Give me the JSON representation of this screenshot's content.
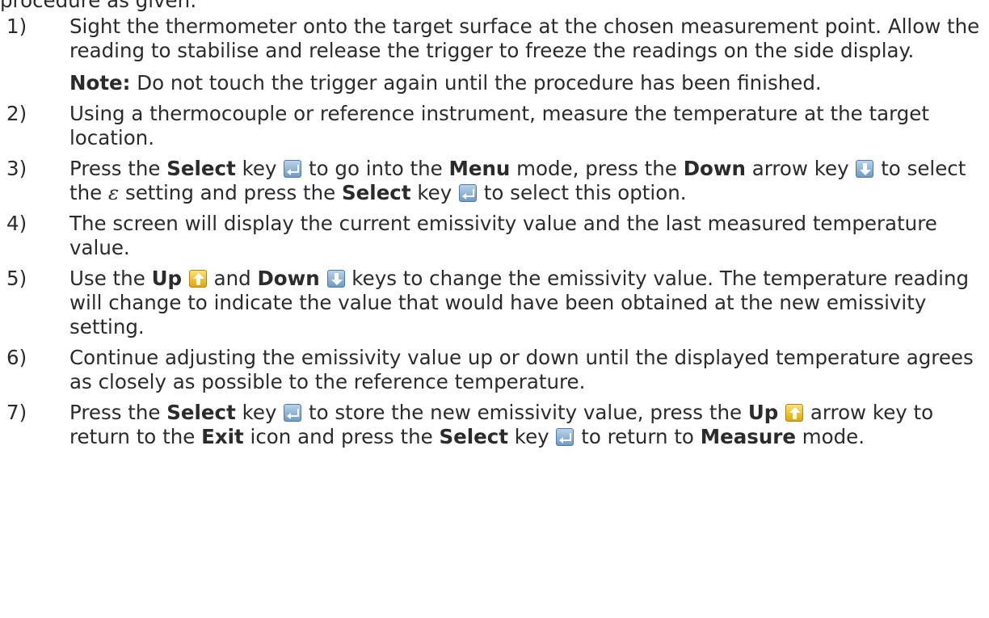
{
  "top_fragment": "procedure as given:",
  "steps": [
    {
      "num": "1)",
      "text": "Sight the thermometer onto the target surface at the chosen measurement point. Allow the reading to stabilise and release the trigger to freeze the readings on the side display.",
      "note_label": "Note:",
      "note_text": " Do not touch the trigger again until the procedure has been finished."
    },
    {
      "num": "2)",
      "text": "Using a thermocouple or reference instrument, measure the temperature at the target location."
    },
    {
      "num": "3)",
      "t1": "Press the ",
      "b1": "Select",
      "t2": " key ",
      "t3": " to go into the ",
      "b2": "Menu",
      "t4": " mode, press the ",
      "b3": "Down",
      "t5": " arrow key ",
      "t6": " to select the ",
      "symbol": "ε",
      "t7": " setting and press the ",
      "b4": "Select",
      "t8": " key ",
      "t9": " to select this option."
    },
    {
      "num": "4)",
      "text": "The screen will display the current emissivity value and the last measured temperature value."
    },
    {
      "num": "5)",
      "t1": "Use the ",
      "b1": "Up",
      "t2": " and ",
      "b2": "Down",
      "t3": " keys to change the emissivity value. The temperature reading will change to indicate the value that would have been obtained at the new emissivity setting."
    },
    {
      "num": "6)",
      "text": "Continue adjusting the emissivity value up or down until the displayed temperature agrees as closely as possible to the reference temperature."
    },
    {
      "num": "7)",
      "t1": "Press the ",
      "b1": "Select",
      "t2": " key ",
      "t3": " to store the new emissivity value, press the ",
      "b2": "Up",
      "t4": " arrow key to return to the ",
      "b3": "Exit",
      "t5": " icon and press the ",
      "b4": "Select",
      "t6": " key ",
      "t7": " to return to ",
      "b5": "Measure",
      "t8": " mode."
    }
  ],
  "icons": {
    "select_key": "select-key-icon",
    "down_key": "down-arrow-key-icon",
    "up_key": "up-arrow-key-icon"
  },
  "colors": {
    "text": "#2b2b2b",
    "select_key": "#6e9bc6",
    "up_key": "#e0a50d"
  }
}
